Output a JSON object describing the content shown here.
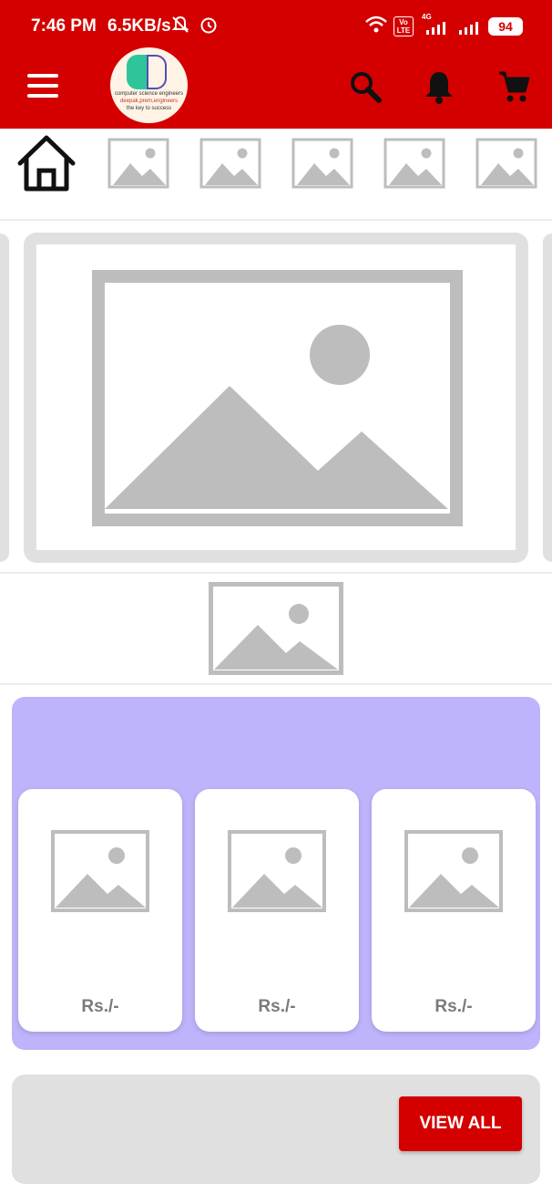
{
  "status_bar": {
    "time": "7:46 PM",
    "speed": "6.5KB/s",
    "network": "4G",
    "volte": "Vo LTE",
    "battery": "94"
  },
  "app_bar": {
    "logo_text_line1": "computer science engineers",
    "logo_text_line2": "deepak,prem,engineers",
    "logo_text_line3": "the key to success",
    "icons": [
      "menu-icon",
      "search-icon",
      "bell-icon",
      "cart-icon"
    ]
  },
  "categories": [
    "home-icon",
    "image-placeholder",
    "image-placeholder",
    "image-placeholder",
    "image-placeholder",
    "image-placeholder"
  ],
  "deals": {
    "products": [
      {
        "price": "Rs./-"
      },
      {
        "price": "Rs./-"
      },
      {
        "price": "Rs./-"
      }
    ]
  },
  "bottom_section": {
    "view_all_label": "VIEW ALL"
  },
  "colors": {
    "brand_red": "#d40000",
    "deal_background": "#beb4fb",
    "placeholder_gray": "#bdbdbd"
  }
}
